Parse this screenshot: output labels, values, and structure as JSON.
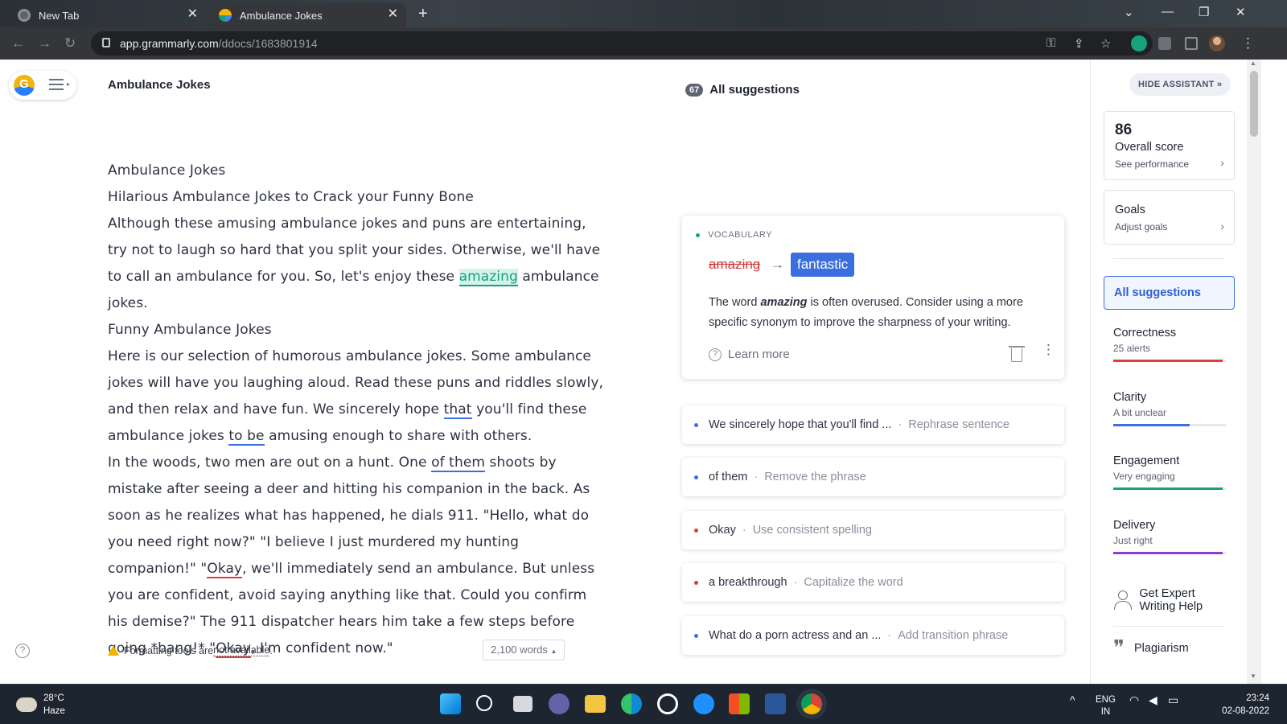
{
  "browser": {
    "tabs": [
      {
        "title": "New Tab"
      },
      {
        "title": "Ambulance Jokes"
      }
    ],
    "url_host": "app.grammarly.com",
    "url_path": "/ddocs/1683801914"
  },
  "document": {
    "title": "Ambulance Jokes",
    "paragraphs": {
      "p1": "Ambulance Jokes",
      "p2": "Hilarious Ambulance Jokes to Crack your Funny Bone",
      "p3a": "Although these amusing ambulance jokes and puns are entertaining, try not to laugh so hard that you split your sides. Otherwise, we'll have to call an ambulance for you. So, let's enjoy these ",
      "p3b": "amazing",
      "p3c": " ambulance jokes.",
      "p4": "Funny Ambulance Jokes",
      "p5a": "Here is our selection of humorous ambulance jokes. Some ambulance jokes will have you laughing aloud. Read these puns and riddles slowly, and then relax and have fun. We sincerely hope ",
      "p5b": "that",
      "p5c": " you'll find these ambulance jokes ",
      "p5d": "to be",
      "p5e": " amusing enough to share with others.",
      "p6a": "In the woods, two men are out on a hunt. One ",
      "p6b": "of them",
      "p6c": " shoots by mistake after seeing a deer and hitting his companion in the back. As soon as he realizes what has happened, he dials 911. \"Hello, what do you need right now?\" \"I believe I just murdered my hunting companion!\" \"",
      "p6d": "Okay",
      "p6e": ", we'll immediately send an ambulance. But unless you are confident, avoid saying anything like that. Could you confirm his demise?\" The 911 dispatcher hears him take a few steps before going *bang!* \"",
      "p6f": "Okay",
      "p6g": ", I'm confident now.\""
    },
    "warning_prefix": "Formatting tools are ",
    "warning_link": "not available",
    "warning_suffix": ".",
    "word_count": "2,100 words"
  },
  "suggestions": {
    "count": "67",
    "header": "All suggestions",
    "main_card": {
      "category": "VOCABULARY",
      "original": "amazing",
      "replacement": "fantastic",
      "desc_pre": "The word ",
      "desc_word": "amazing",
      "desc_post": " is often overused. Consider using a more specific synonym to improve the sharpness of your writing.",
      "learn_more": "Learn more"
    },
    "items": [
      {
        "text": "We sincerely hope that you'll find ...",
        "action": "Rephrase sentence"
      },
      {
        "text": "of them",
        "action": "Remove the phrase"
      },
      {
        "text": "Okay",
        "action": "Use consistent spelling"
      },
      {
        "text": "a breakthrough",
        "action": "Capitalize the word"
      },
      {
        "text": "What do a porn actress and an ...",
        "action": "Add transition phrase"
      }
    ],
    "colors": {
      "blue": "#3b6fe0",
      "red": "#e23b3b",
      "green": "#15a37b"
    }
  },
  "assistant": {
    "hide_label": "HIDE ASSISTANT",
    "score": "86",
    "score_label": "Overall score",
    "score_link": "See performance",
    "goals_label": "Goals",
    "goals_link": "Adjust goals",
    "all_suggestions": "All suggestions",
    "metrics": [
      {
        "name": "Correctness",
        "status": "25 alerts",
        "color": "#e23b3b",
        "level": 0.97
      },
      {
        "name": "Clarity",
        "status": "A bit unclear",
        "color": "#3b6fe0",
        "level": 0.68
      },
      {
        "name": "Engagement",
        "status": "Very engaging",
        "color": "#15a37b",
        "level": 0.97
      },
      {
        "name": "Delivery",
        "status": "Just right",
        "color": "#8b3fd1",
        "level": 0.97
      }
    ],
    "expert_help": "Get Expert Writing Help",
    "plagiarism": "Plagiarism"
  },
  "taskbar": {
    "temperature": "28°C",
    "weather": "Haze",
    "lang_top": "ENG",
    "lang_bottom": "IN",
    "time": "23:24",
    "date": "02-08-2022"
  }
}
